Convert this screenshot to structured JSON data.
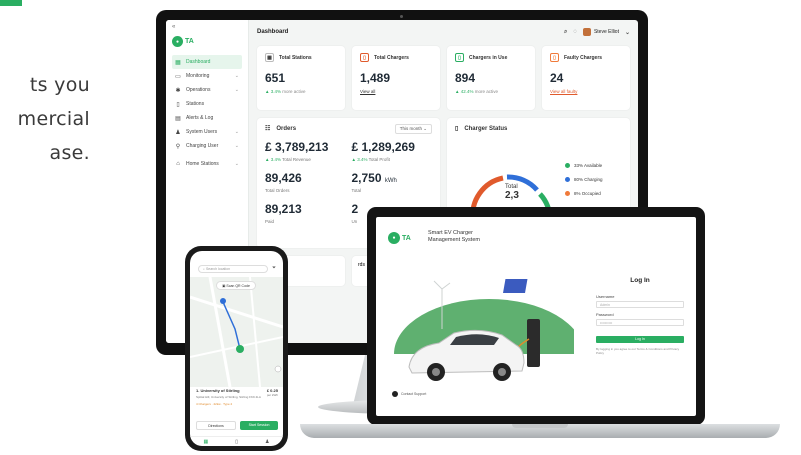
{
  "background_text": {
    "lines": [
      "ts you",
      "mercial",
      "ase."
    ]
  },
  "colors": {
    "accent": "#2aae62",
    "available": "#2aae62",
    "charging": "#2f6fd8",
    "occupied": "#f07a3a",
    "faulty": "#e05a2c"
  },
  "desktop": {
    "sidebar": {
      "logo_text": "TA",
      "items": [
        {
          "label": "Dashboard",
          "icon": "grid-icon",
          "active": true
        },
        {
          "label": "Monitoring",
          "icon": "monitor-icon"
        },
        {
          "label": "Operations",
          "icon": "gear-icon"
        },
        {
          "label": "Stations",
          "icon": "station-icon"
        },
        {
          "label": "Alerts & Log",
          "icon": "bell-icon"
        },
        {
          "label": "System Users",
          "icon": "user-icon"
        },
        {
          "label": "Charging User",
          "icon": "plug-icon"
        },
        {
          "label": "Home Stations",
          "icon": "home-icon"
        }
      ]
    },
    "header": {
      "title": "Dashboard",
      "user_name": "Steve Elliot"
    },
    "cards": [
      {
        "icon": "station-icon",
        "title": "Total Stations",
        "value": "651",
        "delta": "3.4%",
        "delta_label": "more active"
      },
      {
        "icon": "charger-icon",
        "title": "Total Chargers",
        "value": "1,489",
        "link": "View all"
      },
      {
        "icon": "plug-icon",
        "title": "Chargers in Use",
        "value": "894",
        "delta": "42.4%",
        "delta_label": "more active"
      },
      {
        "icon": "warning-icon",
        "title": "Faulty Chargers",
        "value": "24",
        "link": "View all faulty"
      }
    ],
    "orders": {
      "title": "Orders",
      "period": "This month",
      "revenue": "£ 3,789,213",
      "revenue_delta": "3.4%",
      "revenue_label": "Total Revenue",
      "profit": "£ 1,289,269",
      "profit_delta": "3.4%",
      "profit_label": "Total Profit",
      "total_orders": "89,426",
      "total_orders_label": "Total Orders",
      "energy": "2,750",
      "energy_unit": "kWh",
      "energy_label": "Total",
      "paid": "89,213",
      "paid_label": "Paid",
      "unpaid": "2",
      "unpaid_label": "Un"
    },
    "charger_status": {
      "title": "Charger Status",
      "total_label": "Total",
      "total_value": "2,3",
      "legend": [
        {
          "label": "33% Available",
          "percent": 33
        },
        {
          "label": "80% Charging",
          "percent": 80
        },
        {
          "label": "8% Occupied",
          "percent": 8
        }
      ]
    },
    "bottom": [
      "",
      "rds"
    ]
  },
  "laptop": {
    "logo_text": "TA",
    "app_title_1": "Smart EV Charger",
    "app_title_2": "Management System",
    "login": {
      "heading": "Log In",
      "username_label": "Username",
      "username_placeholder": "Admin",
      "password_label": "Password",
      "password_placeholder": "••••••••••",
      "button": "Log In",
      "note": "By logging in you agree to our Terms & Conditions and Privacy Policy"
    },
    "footer": "Contact Support"
  },
  "phone": {
    "search_placeholder": "Search location",
    "scan_label": "Scan QR Code",
    "location": {
      "title": "1. University of Stirling",
      "price": "£ 0.25",
      "price_unit": "per kWh",
      "description": "Spittal Hill, University of Stirling, Stirling FK9 4LA",
      "meta": "4 Chargers · 22kw · Type 2"
    },
    "directions": "Directions",
    "start_button": "Start Session"
  }
}
